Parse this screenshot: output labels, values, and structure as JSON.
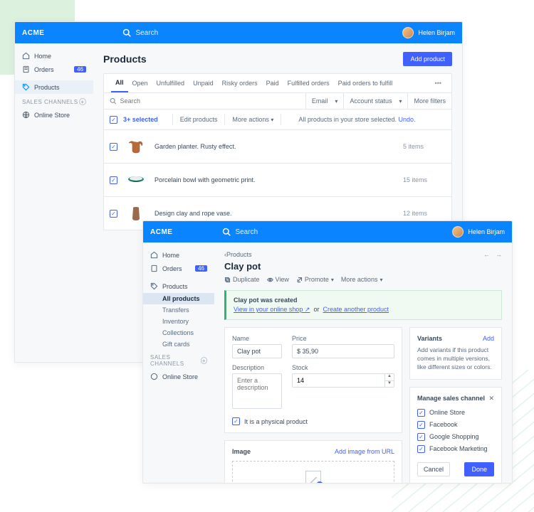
{
  "brand": "ACME",
  "search_placeholder": "Search",
  "user": "Helen Birjam",
  "sidebar": {
    "home": "Home",
    "orders": "Orders",
    "orders_badge": "46",
    "products": "Products",
    "sales_channels": "SALES CHANNELS",
    "online_store": "Online Store"
  },
  "w1": {
    "title": "Products",
    "add_btn": "Add product",
    "tabs": [
      "All",
      "Open",
      "Unfulfilled",
      "Unpaid",
      "Risky orders",
      "Paid",
      "Fulfilled orders",
      "Paid orders to fulfill"
    ],
    "filter_search": "Search",
    "filter_email": "Email",
    "filter_account": "Account status",
    "filter_more": "More filters",
    "bulk_selected": "3+ selected",
    "bulk_edit": "Edit products",
    "bulk_more": "More actions",
    "bulk_note": "All products in your store selected.",
    "bulk_undo": "Undo.",
    "rows": [
      {
        "name": "Garden planter. Rusty effect.",
        "count": "5 items"
      },
      {
        "name": "Porcelain bowl with geometric print.",
        "count": "15 items"
      },
      {
        "name": "Design clay and rope vase.",
        "count": "12 items"
      }
    ]
  },
  "w2": {
    "sidebar_sub": {
      "products": "Products",
      "all_products": "All products",
      "transfers": "Transfers",
      "inventory": "Inventory",
      "collections": "Collections",
      "gift_cards": "Gift cards"
    },
    "crumb_back": "Products",
    "title": "Clay pot",
    "actions": {
      "duplicate": "Duplicate",
      "view": "View",
      "promote": "Promote",
      "more": "More actions"
    },
    "alert_title": "Clay pot was created",
    "alert_view": "View in your online shop",
    "alert_or": "or",
    "alert_create": "Create another product",
    "form": {
      "name_label": "Name",
      "name_value": "Clay pot",
      "desc_label": "Description",
      "desc_placeholder": "Enter a description",
      "price_label": "Price",
      "price_value": "$ 35,90",
      "stock_label": "Stock",
      "stock_value": "14",
      "physical": "It is a physical product"
    },
    "image": {
      "title": "Image",
      "add_url": "Add image from URL"
    },
    "variants": {
      "title": "Variants",
      "add": "Add",
      "desc": "Add variants if this product comes in multiple versions, like different sizes or colors."
    },
    "channels": {
      "title": "Manage sales channel",
      "items": [
        "Online Store",
        "Facebook",
        "Google Shopping",
        "Facebook Marketing"
      ],
      "cancel": "Cancel",
      "done": "Done"
    }
  }
}
